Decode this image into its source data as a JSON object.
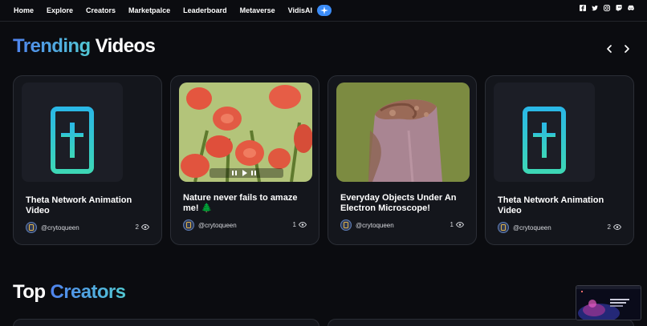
{
  "nav": {
    "links": [
      "Home",
      "Explore",
      "Creators",
      "Marketpalce",
      "Leaderboard",
      "Metaverse",
      "VidisAI"
    ],
    "socials": [
      "facebook-icon",
      "twitter-icon",
      "instagram-icon",
      "twitch-icon",
      "discord-icon"
    ]
  },
  "trending": {
    "title_accent": "Trending",
    "title_rest": "Videos",
    "cards": [
      {
        "title": "Theta Network Animation Video",
        "author": "@crytoqueen",
        "views": "2",
        "thumb": "theta-logo"
      },
      {
        "title": "Nature never fails to amaze me! 🌲",
        "author": "@crytoqueen",
        "views": "1",
        "thumb": "tulips-photo"
      },
      {
        "title": "Everyday Objects Under An Electron Microscope!",
        "author": "@crytoqueen",
        "views": "1",
        "thumb": "microscope-photo"
      },
      {
        "title": "Theta Network Animation Video",
        "author": "@crytoqueen",
        "views": "2",
        "thumb": "theta-logo"
      }
    ]
  },
  "creators": {
    "title_rest": "Top",
    "title_accent": "Creators"
  },
  "colors": {
    "accent_start": "#4f82ee",
    "accent_end": "#52c9d4",
    "background": "#0b0c10",
    "card": "#14161c"
  }
}
